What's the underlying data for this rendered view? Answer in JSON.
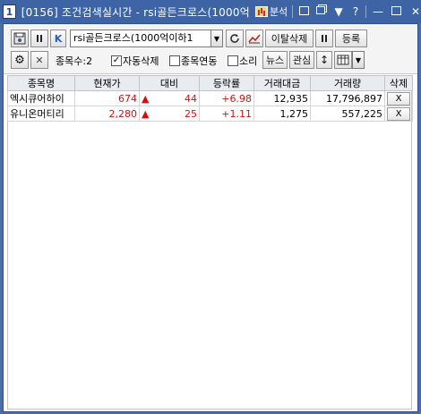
{
  "window": {
    "badge": "1",
    "title": "[0156] 조건검색실시간 - rsi골든크로스(1000억",
    "analysis_label": "분석",
    "buttons": [
      "□",
      "❐",
      "▼",
      "?",
      "—",
      "□",
      "✕"
    ]
  },
  "toolbar": {
    "condition_value": "rsi골든크로스(1000억이하1",
    "search_remove_label": "이탈삭제",
    "register_label": "등록",
    "k_label": "K",
    "item_count_label": "종목수:2",
    "auto_delete_label": "자동삭제",
    "auto_delete_checked": true,
    "link_label": "종목연동",
    "link_checked": false,
    "sound_label": "소리",
    "sound_checked": false,
    "news_label": "뉴스",
    "interest_label": "관심"
  },
  "table": {
    "columns": [
      "종목명",
      "현재가",
      "대비",
      "등락률",
      "거래대금",
      "거래량",
      "삭제"
    ],
    "rows": [
      {
        "name": "엑시큐어하이",
        "price": "674",
        "change": "44",
        "rate": "+6.98",
        "amount": "12,935",
        "volume": "17,796,897",
        "del": "X"
      },
      {
        "name": "유니온머티리",
        "price": "2,280",
        "change": "25",
        "rate": "+1.11",
        "amount": "1,275",
        "volume": "557,225",
        "del": "X"
      }
    ]
  },
  "colors": {
    "titlebar": "#3f64a6",
    "up": "#d01010"
  }
}
